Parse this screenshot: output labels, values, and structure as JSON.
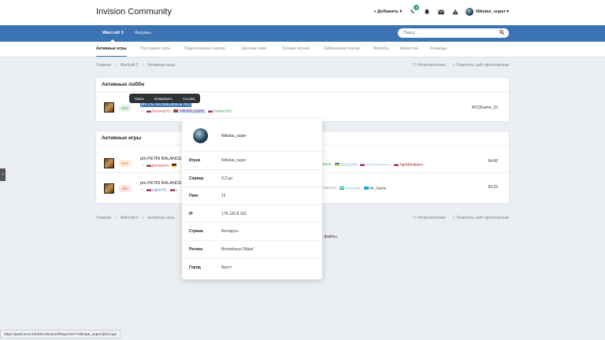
{
  "header": {
    "brand": "Invision Community",
    "add_label": "+ Добавить ▾",
    "notification_count": "3",
    "username": "Nikolas_super ▾",
    "icons": [
      "tag-icon",
      "bell-icon",
      "envelope-icon",
      "warning-icon"
    ]
  },
  "nav": {
    "tabs": [
      {
        "label": "Warcraft 3",
        "active": true
      },
      {
        "label": "Форумы",
        "active": false
      }
    ],
    "search_placeholder": "Поиск..."
  },
  "subnav": {
    "tabs": [
      {
        "label": "Активные игры",
        "active": true
      },
      {
        "label": "Последние игры"
      },
      {
        "label": "Подключенные игроки"
      },
      {
        "label": "Цветные ники"
      },
      {
        "label": "Лучшие игроки"
      },
      {
        "label": "Забаненные игроки"
      },
      {
        "label": "Жалобы"
      },
      {
        "label": "Амнистии"
      },
      {
        "label": "Команды"
      }
    ]
  },
  "breadcrumb": {
    "items": [
      "Главная",
      "›",
      "Warcraft 3",
      "›",
      "Активные игры"
    ],
    "unread": "☐ Непрочитанное",
    "mark_read": "✓ Отметить сайт прочитанным"
  },
  "context_menu": {
    "items": [
      "Поиск",
      "Копировать",
      "Ссылка"
    ]
  },
  "lobbies": {
    "title": "Активные лобби",
    "rows": [
      {
        "slots": "3/11",
        "slot_color": "green",
        "name": "ptn PETRI BALANCE #52",
        "players": [
          {
            "flag": "ru",
            "name": "DinampXD,",
            "color": "#d33434"
          },
          {
            "flag": "by",
            "name": "Nikolas_super,",
            "color": "#7b3aa8"
          },
          {
            "flag": "ru",
            "name": "Stakan195",
            "color": "#2e9f3d"
          }
        ],
        "host": "WC3Game_10"
      }
    ]
  },
  "games": {
    "title": "Активные игры",
    "rows": [
      {
        "slots": "9/11",
        "slot_color": "orange",
        "name": "ptn PETRI BALANCE",
        "players_left": [
          {
            "flag": "ru",
            "name": "parsepom,",
            "color": "#d33434"
          },
          {
            "flag": "de",
            "name": "",
            "color": "#333"
          }
        ],
        "players_right": [
          {
            "flag": "",
            "name": "ftuce,",
            "color": "#2e9f3d"
          },
          {
            "flag": "ua",
            "name": "20122009,",
            "color": "#7d9cc4"
          },
          {
            "flag": "ru",
            "name": "mythoneanime,",
            "color": "#a9c2dd"
          },
          {
            "flag": "ru",
            "name": "Tap0kSabotro",
            "color": "#8a1010"
          }
        ],
        "time": "64:42"
      },
      {
        "slots": "9/9",
        "slot_color": "red",
        "name": "ptn PETRI BALANCE",
        "players_left": [
          {
            "flag": "ru",
            "name": "Lipton72,",
            "color": "#3b73b4"
          },
          {
            "flag": "ru",
            "name": "L",
            "color": "#d33434"
          }
        ],
        "players_right": [
          {
            "flag": "",
            "name": "ialker01,",
            "color": "#8aa0b8"
          },
          {
            "flag": "uz",
            "name": "nancy0rk,",
            "color": "#7ab5d8"
          },
          {
            "flag": "kz",
            "name": "Mr_Game",
            "color": "#222"
          }
        ],
        "time": "50:23"
      }
    ]
  },
  "popover": {
    "name": "Nikolas_super",
    "fields": [
      {
        "label": "Игрок",
        "value": "Nikolas_super"
      },
      {
        "label": "Сервер",
        "value": "iCCup"
      },
      {
        "label": "Пинг",
        "value": "15"
      },
      {
        "label": "IP",
        "value": "178.120.8.192"
      },
      {
        "label": "Страна",
        "value": "Беларусь"
      },
      {
        "label": "Регион",
        "value": "Brestskaya Oblast'"
      },
      {
        "label": "Город",
        "value": "Брест"
      }
    ]
  },
  "files_text": "-файлы",
  "left_tab": "›",
  "status_url": "https://petri.wc3.info/WC3Game/Players/27-Nikolas_super@iCCup/"
}
